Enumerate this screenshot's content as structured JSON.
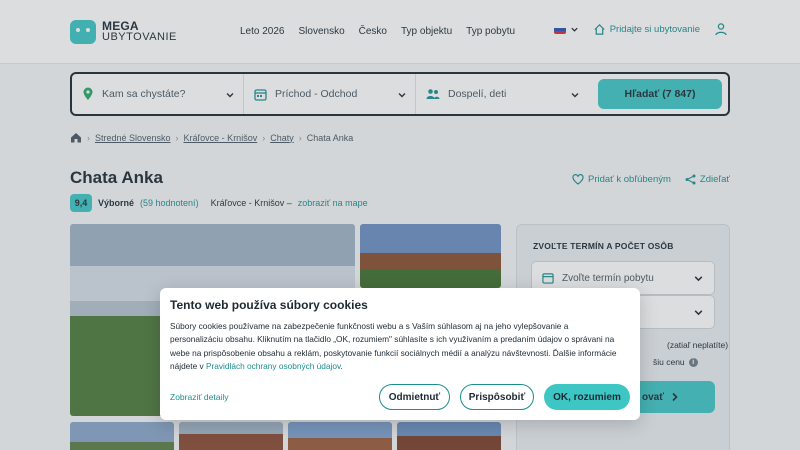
{
  "header": {
    "logo_line1": "MEGA",
    "logo_line2": "UBYTOVANIE",
    "nav": [
      "Leto 2026",
      "Slovensko",
      "Česko",
      "Typ objektu",
      "Typ pobytu"
    ],
    "add_property": "Pridajte si ubytovanie",
    "language_icon": "slovak-flag"
  },
  "search": {
    "destination_placeholder": "Kam sa chystáte?",
    "dates_placeholder": "Príchod - Odchod",
    "guests_placeholder": "Dospelí, deti",
    "button_label": "Hľadať (7 847)"
  },
  "breadcrumb": [
    "Stredné Slovensko",
    "Kráľovce - Krnišov",
    "Chaty",
    "Chata Anka"
  ],
  "listing": {
    "title": "Chata Anka",
    "score": "9,4",
    "rating_label": "Výborné",
    "reviews": "(59 hodnotení)",
    "location": "Kráľovce - Krnišov –",
    "map_link": "zobraziť na mape",
    "favorite": "Pridať k obľúbeným",
    "share": "Zdieľať"
  },
  "booking": {
    "title": "ZVOĽTE TERMÍN A POČET OSÔB",
    "date_field": "Zvoľte termín pobytu",
    "note1": "(zatiaľ neplatíte)",
    "note2": "šiu cenu",
    "button_label": "ovať"
  },
  "cookie": {
    "title": "Tento web používa súbory cookies",
    "text_before_link": "Súbory cookies používame na zabezpečenie funkčnosti webu a s Vaším súhlasom aj na jeho vylepšovanie a personalizáciu obsahu. Kliknutím na tlačidlo „OK, rozumiem\" súhlasíte s ich využívaním a predaním údajov o správani na webe na prispôsobenie obsahu a reklám, poskytovanie funkcií sociálnych médií a analýzu návštevnosti. Ďalšie informácie nájdete v",
    "policy_link": "Pravidlách ochrany osobných údajov",
    "text_after_link": ".",
    "details_link": "Zobraziť detaily",
    "reject_label": "Odmietnuť",
    "customize_label": "Prispôsobiť",
    "accept_label": "OK, rozumiem"
  },
  "colors": {
    "accent": "#3ec6c4",
    "link": "#1b8f8f",
    "text": "#1d2a33"
  }
}
